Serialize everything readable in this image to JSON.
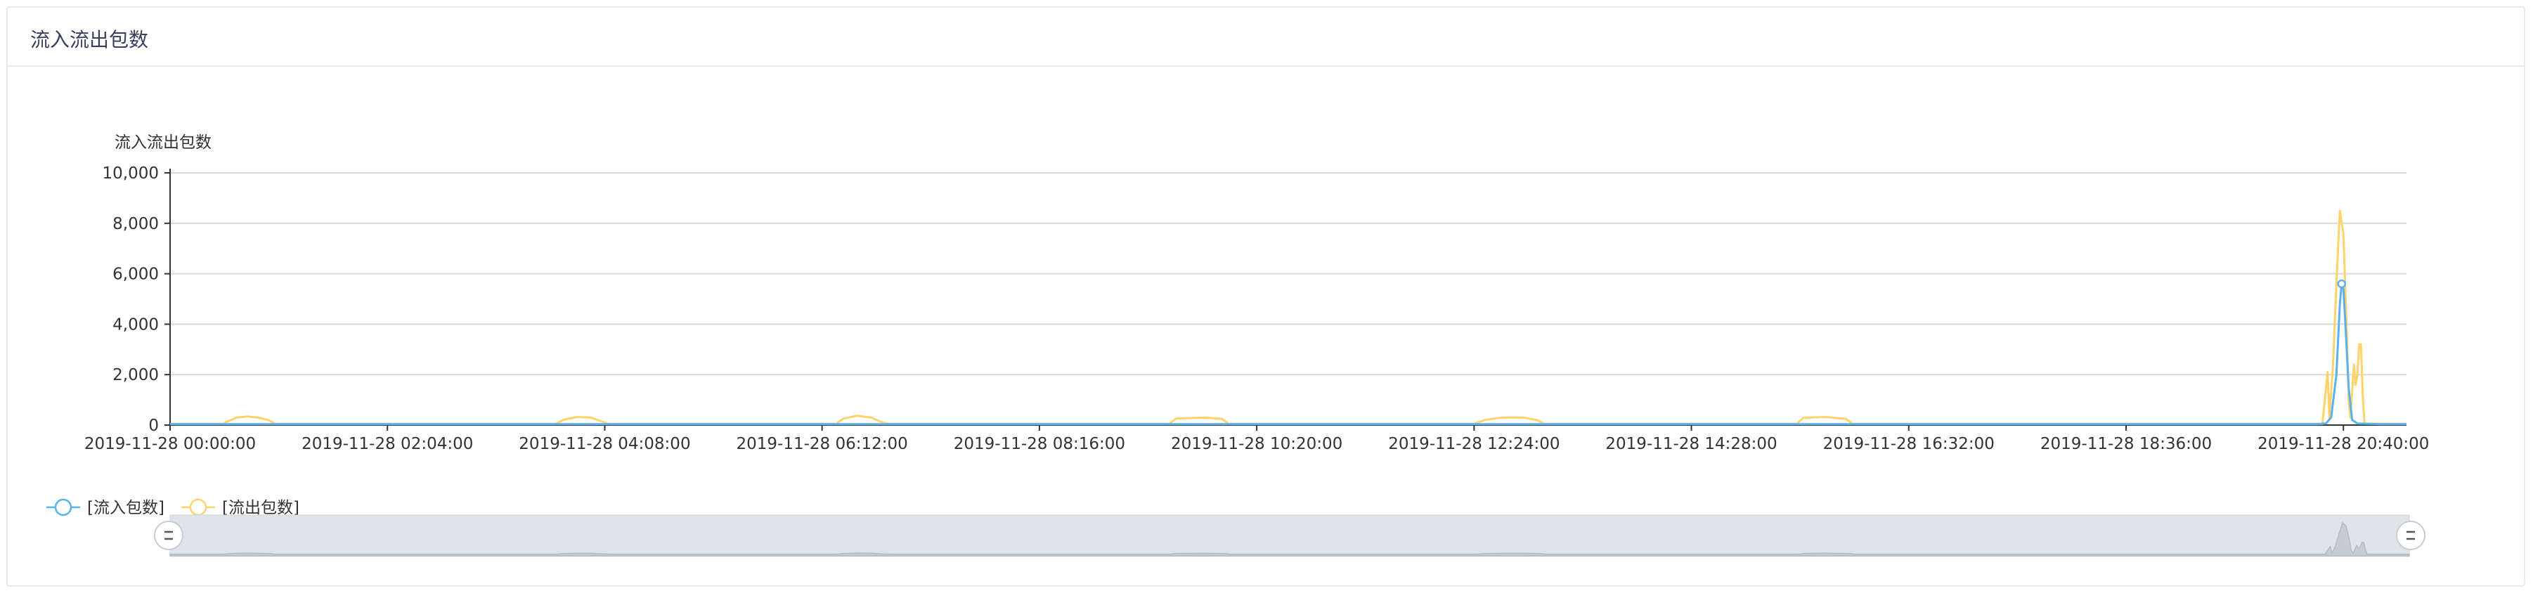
{
  "panel": {
    "title": "流入流出包数"
  },
  "chart_data": {
    "type": "line",
    "ylabel": "流入流出包数",
    "ylim": [
      0,
      10000
    ],
    "yticks": [
      "0",
      "2,000",
      "4,000",
      "6,000",
      "8,000",
      "10,000"
    ],
    "xlim": [
      "2019-11-28 00:00:00",
      "2019-11-28 21:16:00"
    ],
    "xticks": [
      "2019-11-28 00:00:00",
      "2019-11-28 02:04:00",
      "2019-11-28 04:08:00",
      "2019-11-28 06:12:00",
      "2019-11-28 08:16:00",
      "2019-11-28 10:20:00",
      "2019-11-28 12:24:00",
      "2019-11-28 14:28:00",
      "2019-11-28 16:32:00",
      "2019-11-28 18:36:00",
      "2019-11-28 20:40:00"
    ],
    "grid": true,
    "legend_position": "bottom-left",
    "series": [
      {
        "name": "[流入包数]",
        "color": "#5ab1ef",
        "points": [
          [
            "2019-11-28 00:00:00",
            40
          ],
          [
            "2019-11-28 03:00:00",
            40
          ],
          [
            "2019-11-28 06:00:00",
            40
          ],
          [
            "2019-11-28 09:00:00",
            40
          ],
          [
            "2019-11-28 12:00:00",
            40
          ],
          [
            "2019-11-28 15:00:00",
            40
          ],
          [
            "2019-11-28 18:00:00",
            40
          ],
          [
            "2019-11-28 20:25:00",
            40
          ],
          [
            "2019-11-28 20:30:00",
            60
          ],
          [
            "2019-11-28 20:33:00",
            300
          ],
          [
            "2019-11-28 20:36:00",
            2000
          ],
          [
            "2019-11-28 20:38:00",
            4800
          ],
          [
            "2019-11-28 20:39:00",
            5600
          ],
          [
            "2019-11-28 20:40:00",
            5400
          ],
          [
            "2019-11-28 20:41:00",
            4200
          ],
          [
            "2019-11-28 20:43:00",
            1500
          ],
          [
            "2019-11-28 20:45:00",
            200
          ],
          [
            "2019-11-28 20:48:00",
            60
          ],
          [
            "2019-11-28 21:00:00",
            40
          ],
          [
            "2019-11-28 21:16:00",
            40
          ]
        ]
      },
      {
        "name": "[流出包数]",
        "color": "#ffd36b",
        "points": [
          [
            "2019-11-28 00:00:00",
            50
          ],
          [
            "2019-11-28 00:30:00",
            50
          ],
          [
            "2019-11-28 00:34:00",
            180
          ],
          [
            "2019-11-28 00:38:00",
            300
          ],
          [
            "2019-11-28 00:44:00",
            340
          ],
          [
            "2019-11-28 00:50:00",
            300
          ],
          [
            "2019-11-28 00:56:00",
            200
          ],
          [
            "2019-11-28 01:00:00",
            50
          ],
          [
            "2019-11-28 03:40:00",
            50
          ],
          [
            "2019-11-28 03:45:00",
            220
          ],
          [
            "2019-11-28 03:52:00",
            320
          ],
          [
            "2019-11-28 04:00:00",
            300
          ],
          [
            "2019-11-28 04:06:00",
            150
          ],
          [
            "2019-11-28 04:10:00",
            50
          ],
          [
            "2019-11-28 06:20:00",
            50
          ],
          [
            "2019-11-28 06:24:00",
            250
          ],
          [
            "2019-11-28 06:32:00",
            370
          ],
          [
            "2019-11-28 06:40:00",
            300
          ],
          [
            "2019-11-28 06:46:00",
            120
          ],
          [
            "2019-11-28 06:50:00",
            50
          ],
          [
            "2019-11-28 09:30:00",
            50
          ],
          [
            "2019-11-28 09:34:00",
            260
          ],
          [
            "2019-11-28 09:50:00",
            300
          ],
          [
            "2019-11-28 10:00:00",
            250
          ],
          [
            "2019-11-28 10:04:00",
            50
          ],
          [
            "2019-11-28 12:24:00",
            50
          ],
          [
            "2019-11-28 12:30:00",
            200
          ],
          [
            "2019-11-28 12:40:00",
            300
          ],
          [
            "2019-11-28 12:52:00",
            300
          ],
          [
            "2019-11-28 13:00:00",
            200
          ],
          [
            "2019-11-28 13:04:00",
            50
          ],
          [
            "2019-11-28 15:28:00",
            50
          ],
          [
            "2019-11-28 15:32:00",
            290
          ],
          [
            "2019-11-28 15:44:00",
            320
          ],
          [
            "2019-11-28 15:56:00",
            250
          ],
          [
            "2019-11-28 16:00:00",
            50
          ],
          [
            "2019-11-28 20:28:00",
            50
          ],
          [
            "2019-11-28 20:31:00",
            2100
          ],
          [
            "2019-11-28 20:32:00",
            300
          ],
          [
            "2019-11-28 20:34:00",
            2300
          ],
          [
            "2019-11-28 20:36:00",
            5600
          ],
          [
            "2019-11-28 20:38:00",
            8500
          ],
          [
            "2019-11-28 20:40:00",
            7600
          ],
          [
            "2019-11-28 20:42:00",
            3600
          ],
          [
            "2019-11-28 20:43:00",
            1000
          ],
          [
            "2019-11-28 20:44:00",
            300
          ],
          [
            "2019-11-28 20:46:00",
            2400
          ],
          [
            "2019-11-28 20:47:00",
            1600
          ],
          [
            "2019-11-28 20:48:00",
            2000
          ],
          [
            "2019-11-28 20:49:00",
            3200
          ],
          [
            "2019-11-28 20:50:00",
            3200
          ],
          [
            "2019-11-28 20:51:00",
            1200
          ],
          [
            "2019-11-28 20:52:00",
            60
          ],
          [
            "2019-11-28 21:16:00",
            50
          ]
        ]
      }
    ],
    "data_zoom": {
      "start_percent": 0,
      "end_percent": 100
    }
  }
}
